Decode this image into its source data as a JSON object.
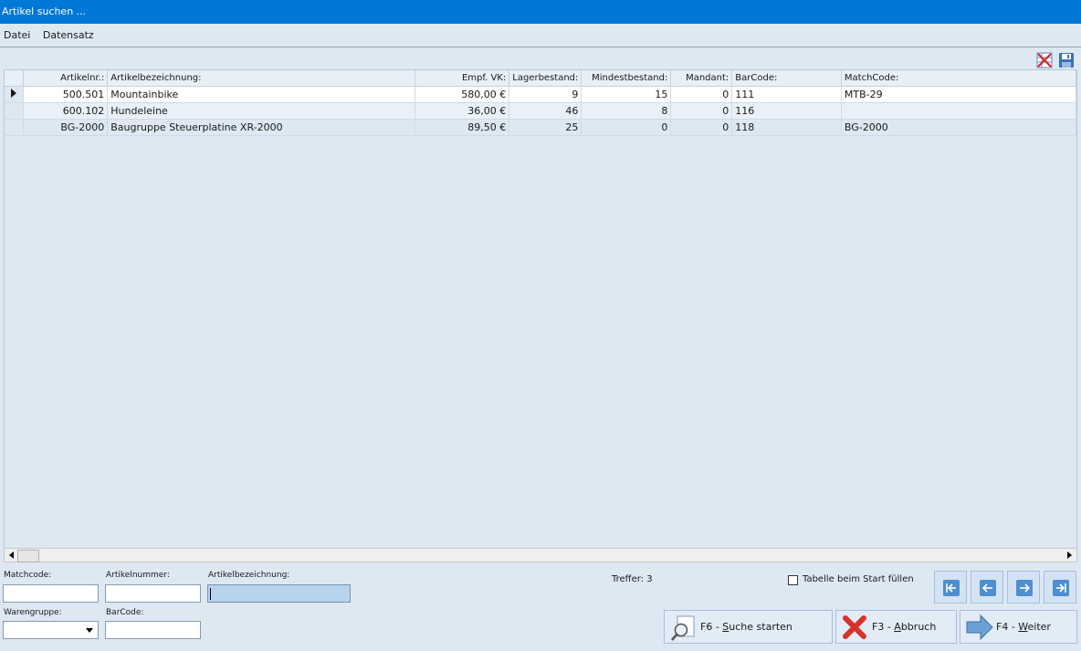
{
  "window": {
    "title": "Artikel suchen ..."
  },
  "menu": {
    "file": "Datei",
    "record": "Datensatz"
  },
  "table": {
    "headers": [
      "Artikelnr.:",
      "Artikelbezeichnung:",
      "Empf. VK:",
      "Lagerbestand:",
      "Mindestbestand:",
      "Mandant:",
      "BarCode:",
      "MatchCode:"
    ],
    "rows": [
      [
        "500.501",
        "Mountainbike",
        "580,00 €",
        "9",
        "15",
        "0",
        "111",
        "MTB-29"
      ],
      [
        "600.102",
        "Hundeleine",
        "36,00 €",
        "46",
        "8",
        "0",
        "116",
        ""
      ],
      [
        "BG-2000",
        "Baugruppe Steuerplatine XR-2000",
        "89,50 €",
        "25",
        "0",
        "0",
        "118",
        "BG-2000"
      ]
    ]
  },
  "filters": {
    "matchcode_label": "Matchcode:",
    "matchcode_value": "",
    "artikelnummer_label": "Artikelnummer:",
    "artikelnummer_value": "",
    "artikelbezeichnung_label": "Artikelbezeichnung:",
    "artikelbezeichnung_value": "",
    "warengruppe_label": "Warengruppe:",
    "warengruppe_value": "",
    "barcode_label": "BarCode:",
    "barcode_value": ""
  },
  "status": {
    "hits": "Treffer: 3"
  },
  "options": {
    "fill_on_start_label": "Tabelle beim Start füllen",
    "fill_on_start_checked": false
  },
  "buttons": {
    "search_prefix": "F6 - ",
    "search_key": "S",
    "search_rest": "uche starten",
    "cancel_prefix": "F3 - ",
    "cancel_key": "A",
    "cancel_rest": "bbruch",
    "next_prefix": "F4 - ",
    "next_key": "W",
    "next_rest": "eiter"
  },
  "icons": {
    "delete": "delete-table-icon",
    "save": "save-icon",
    "search": "magnifier-icon",
    "cancel": "red-x-icon",
    "next": "blue-arrow-icon"
  },
  "colors": {
    "titlebar": "#0078d7",
    "background": "#dde8f3",
    "focused_input": "#b7d3ee"
  }
}
